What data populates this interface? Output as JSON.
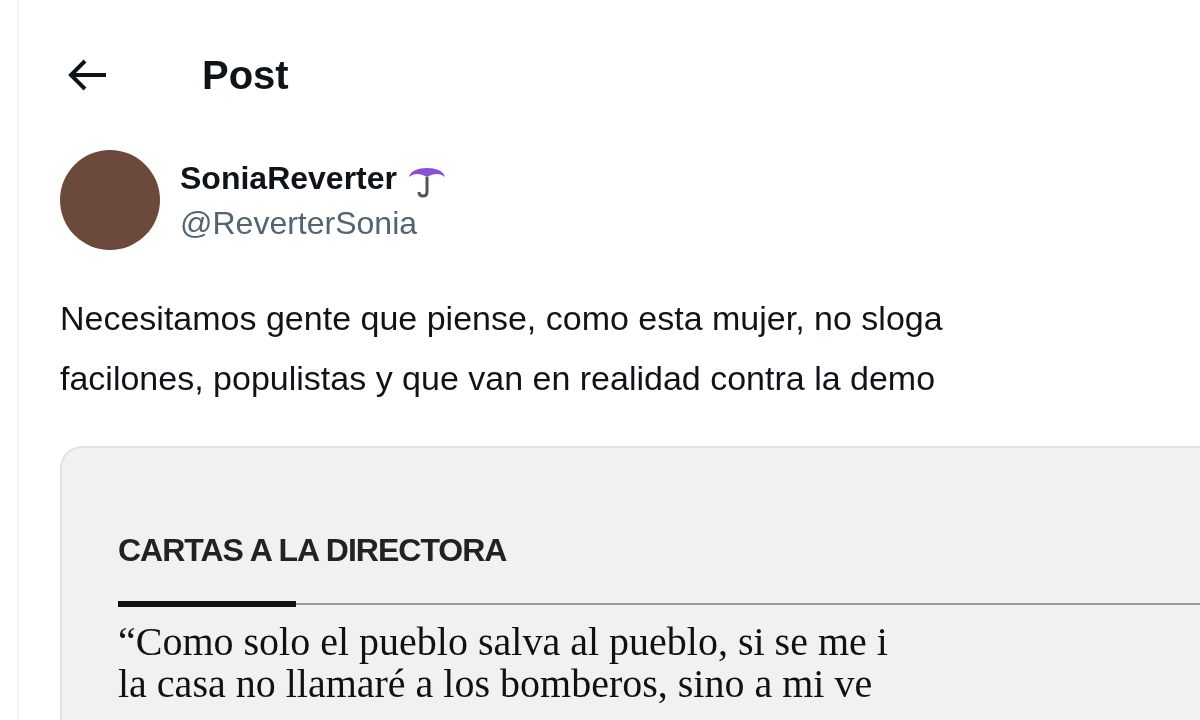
{
  "header": {
    "title": "Post"
  },
  "author": {
    "name": "SoniaReverter",
    "handle": "@ReverterSonia"
  },
  "text": [
    "Necesitamos gente que piense, como esta mujer, no sloga",
    "facilones, populistas y que van en realidad contra la demo"
  ],
  "media": {
    "section": "CARTAS A LA DIRECTORA",
    "lines": [
      "“Como solo el pueblo salva al pueblo, si se me i",
      "la casa no llamaré a los bomberos, sino a mi ve"
    ]
  }
}
